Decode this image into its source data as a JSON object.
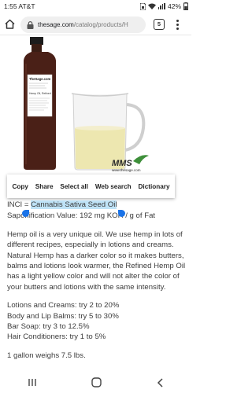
{
  "status_bar": {
    "time": "1:55 AT&T",
    "battery": "42%",
    "icons": [
      "sim-icon",
      "wifi-icon",
      "signal-icon",
      "battery-icon"
    ]
  },
  "browser": {
    "url_host": "thesage.com",
    "url_path": "/catalog/products/H",
    "tab_count": "5",
    "icons": [
      "home-icon",
      "lock-icon",
      "tabs-icon",
      "more-menu-icon"
    ]
  },
  "image": {
    "bottle_label_brand": "TheSage.com",
    "bottle_label_product": "Hemp Oil, Refined",
    "watermark_brand": "MMS",
    "watermark_url": "www.thesage.com"
  },
  "context_menu": {
    "items": [
      "Copy",
      "Share",
      "Select all",
      "Web search",
      "Dictionary"
    ]
  },
  "content": {
    "inci_prefix": "INCI = ",
    "inci_value": "Cannabis Sativa Seed Oil",
    "saponification": "Saponification Value: 192 mg KOH / g of Fat",
    "description": "Hemp oil is a very unique oil. We use hemp in lots of different recipes, especially in lotions and creams. Natural Hemp has a darker color so it makes butters, balms and lotions look warmer, the Refined Hemp Oil has a light yellow color and will not alter the color of your butters and lotions with the same intensity.",
    "usage": [
      "Lotions and Creams: try 2 to 20%",
      "Body and Lip Balms: try 5 to 30%",
      "Bar Soap: try 3 to 12.5%",
      "Hair Conditioners: try 1 to 5%"
    ],
    "weight": "1 gallon weighs 7.5 lbs."
  },
  "nav_bar": {
    "icons": [
      "recent-apps-icon",
      "home-button-icon",
      "back-icon"
    ]
  }
}
